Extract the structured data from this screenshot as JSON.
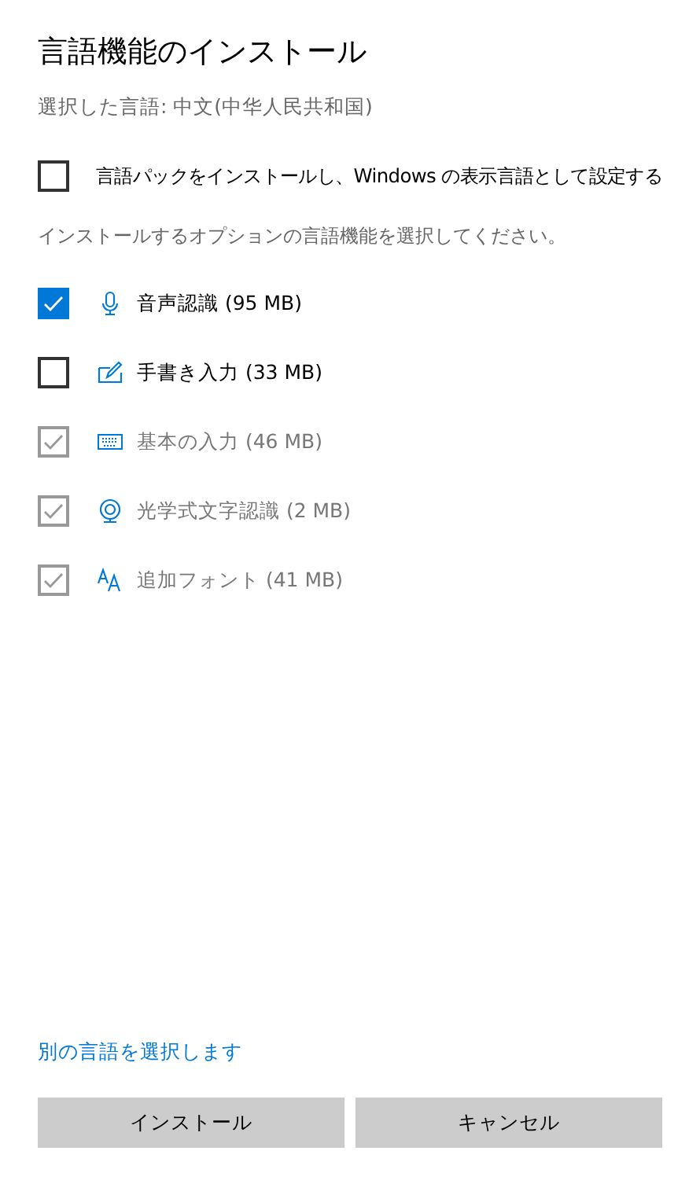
{
  "title": "言語機能のインストール",
  "selected_language": "選択した言語: 中文(中华人民共和国)",
  "language_pack": {
    "label": "言語パックをインストールし、Windows の表示言語として設定する",
    "checked": false
  },
  "instruction": "インストールするオプションの言語機能を選択してください。",
  "features": [
    {
      "kind": "speech",
      "label": "音声認識 (95 MB)",
      "checked": true,
      "disabled": false
    },
    {
      "kind": "handwriting",
      "label": "手書き入力 (33 MB)",
      "checked": false,
      "disabled": false
    },
    {
      "kind": "keyboard",
      "label": "基本の入力 (46 MB)",
      "checked": true,
      "disabled": true
    },
    {
      "kind": "ocr",
      "label": "光学式文字認識 (2 MB)",
      "checked": true,
      "disabled": true
    },
    {
      "kind": "fonts",
      "label": "追加フォント (41 MB)",
      "checked": true,
      "disabled": true
    }
  ],
  "link": "別の言語を選択します",
  "buttons": [
    "インストール",
    "キャンセル"
  ]
}
